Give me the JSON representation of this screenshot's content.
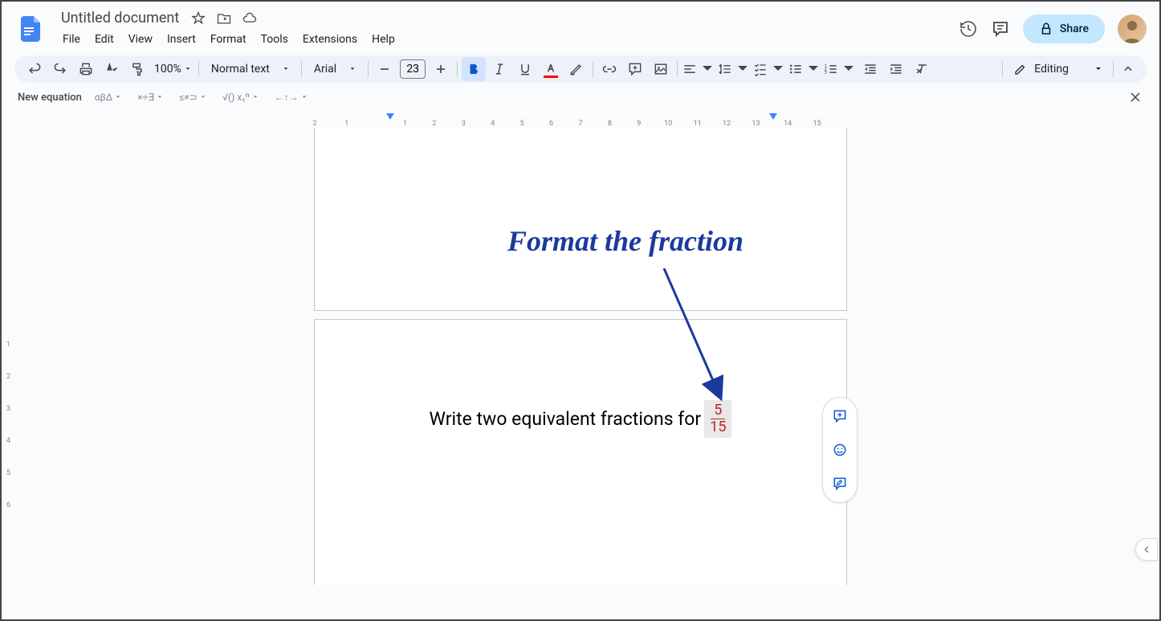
{
  "doc": {
    "title": "Untitled document"
  },
  "menu": {
    "file": "File",
    "edit": "Edit",
    "view": "View",
    "insert": "Insert",
    "format": "Format",
    "tools": "Tools",
    "extensions": "Extensions",
    "help": "Help"
  },
  "toolbar": {
    "zoom": "100%",
    "style": "Normal text",
    "font": "Arial",
    "fontsize": "23",
    "editing": "Editing"
  },
  "share": {
    "label": "Share"
  },
  "equation": {
    "new_label": "New equation",
    "greek": "αβΔ",
    "ops": "×÷∃",
    "rel": "≤≠⊃",
    "math": "√() x₁ⁿ",
    "arrows": "←↑→"
  },
  "ruler": {
    "marks": [
      "2",
      "1",
      "",
      "1",
      "2",
      "3",
      "4",
      "5",
      "6",
      "7",
      "8",
      "9",
      "10",
      "11",
      "12",
      "13",
      "14",
      "15"
    ]
  },
  "vruler": {
    "marks": [
      "",
      "",
      "1",
      "2",
      "3",
      "4",
      "5",
      "6"
    ]
  },
  "content": {
    "text": "Write two equivalent fractions for",
    "numerator": "5",
    "denominator": "15"
  },
  "annotation": {
    "text": "Format the fraction"
  }
}
